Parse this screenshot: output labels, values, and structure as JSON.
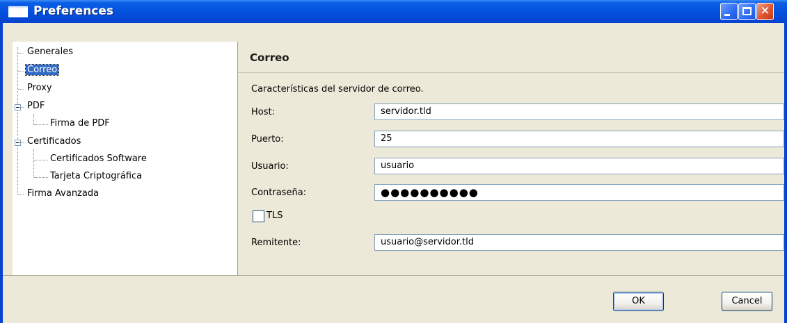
{
  "window": {
    "title": "Preferences"
  },
  "tree": {
    "items": [
      {
        "label": "Generales"
      },
      {
        "label": "Correo"
      },
      {
        "label": "Proxy"
      },
      {
        "label": "PDF"
      },
      {
        "label": "Firma de PDF"
      },
      {
        "label": "Certificados"
      },
      {
        "label": "Certificados Software"
      },
      {
        "label": "Tarjeta Criptográfica"
      },
      {
        "label": "Firma Avanzada"
      }
    ],
    "selected": "Correo"
  },
  "panel": {
    "title": "Correo",
    "description": "Características del servidor de correo.",
    "fields": {
      "host": {
        "label": "Host:",
        "value": "servidor.tld"
      },
      "port": {
        "label": "Puerto:",
        "value": "25"
      },
      "user": {
        "label": "Usuario:",
        "value": "usuario"
      },
      "password": {
        "label": "Contraseña:",
        "value": "●●●●●●●●●●"
      },
      "tls": {
        "label": "TLS",
        "checked": false
      },
      "sender": {
        "label": "Remitente:",
        "value": "usuario@servidor.tld"
      }
    }
  },
  "buttons": {
    "ok": "OK",
    "cancel": "Cancel"
  }
}
